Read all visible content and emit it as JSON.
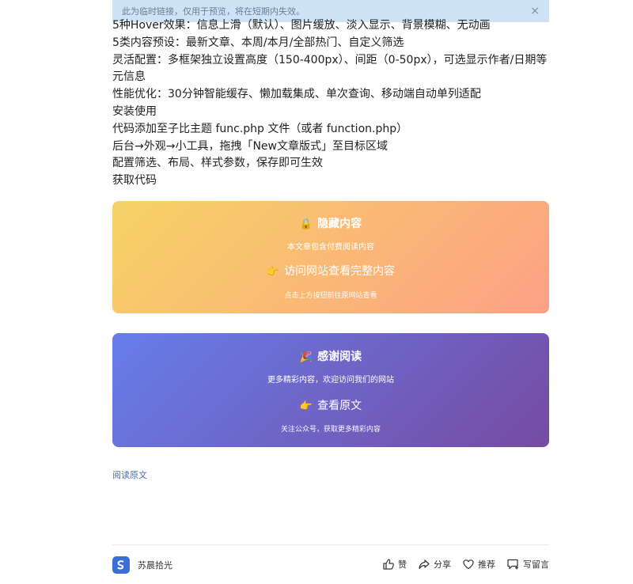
{
  "banner": {
    "text": "此为临时链接，仅用于预览，将在短期内失效。",
    "close_icon": "×"
  },
  "article": {
    "lines": [
      "5种Hover效果：信息上滑（默认）、图片缓放、淡入显示、背景模糊、无动画",
      "5类内容预设：最新文章、本周/本月/全部热门、自定义筛选",
      "灵活配置：多框架独立设置高度（150-400px）、间距（0-50px），可选显示作者/日期等元信息",
      "性能优化：30分钟智能缓存、懒加载集成、单次查询、移动端自动单列适配",
      "安装使用",
      "代码添加至子比主题 func.php 文件（或者 function.php）",
      "后台→外观→小工具，拖拽「New文章版式」至目标区域",
      "配置筛选、布局、样式参数，保存即可生效",
      "获取代码"
    ]
  },
  "hidden_card": {
    "icon": "🔒",
    "title": "隐藏内容",
    "subtitle": "本文章包含付费阅读内容",
    "link_icon": "👉",
    "link": "访问网站查看完整内容",
    "note": "点击上方按钮前往原网站查看"
  },
  "thanks_card": {
    "icon": "🎉",
    "title": "感谢阅读",
    "subtitle": "更多精彩内容，欢迎访问我们的网站",
    "link_icon": "👉",
    "link": "查看原文",
    "note": "关注公众号，获取更多精彩内容"
  },
  "read_original": "阅读原文",
  "footer": {
    "author": "苏晨拾光",
    "actions": {
      "like": "赞",
      "share": "分享",
      "recommend": "推荐",
      "comment": "写留言"
    }
  },
  "colors": {
    "banner_bg": "#cfe3f7",
    "card1_gradient": [
      "#f6d365",
      "#fda085"
    ],
    "card2_gradient": [
      "#667eea",
      "#764ba2"
    ],
    "link": "#4a6fa5",
    "avatar": "#3b6fd8"
  }
}
